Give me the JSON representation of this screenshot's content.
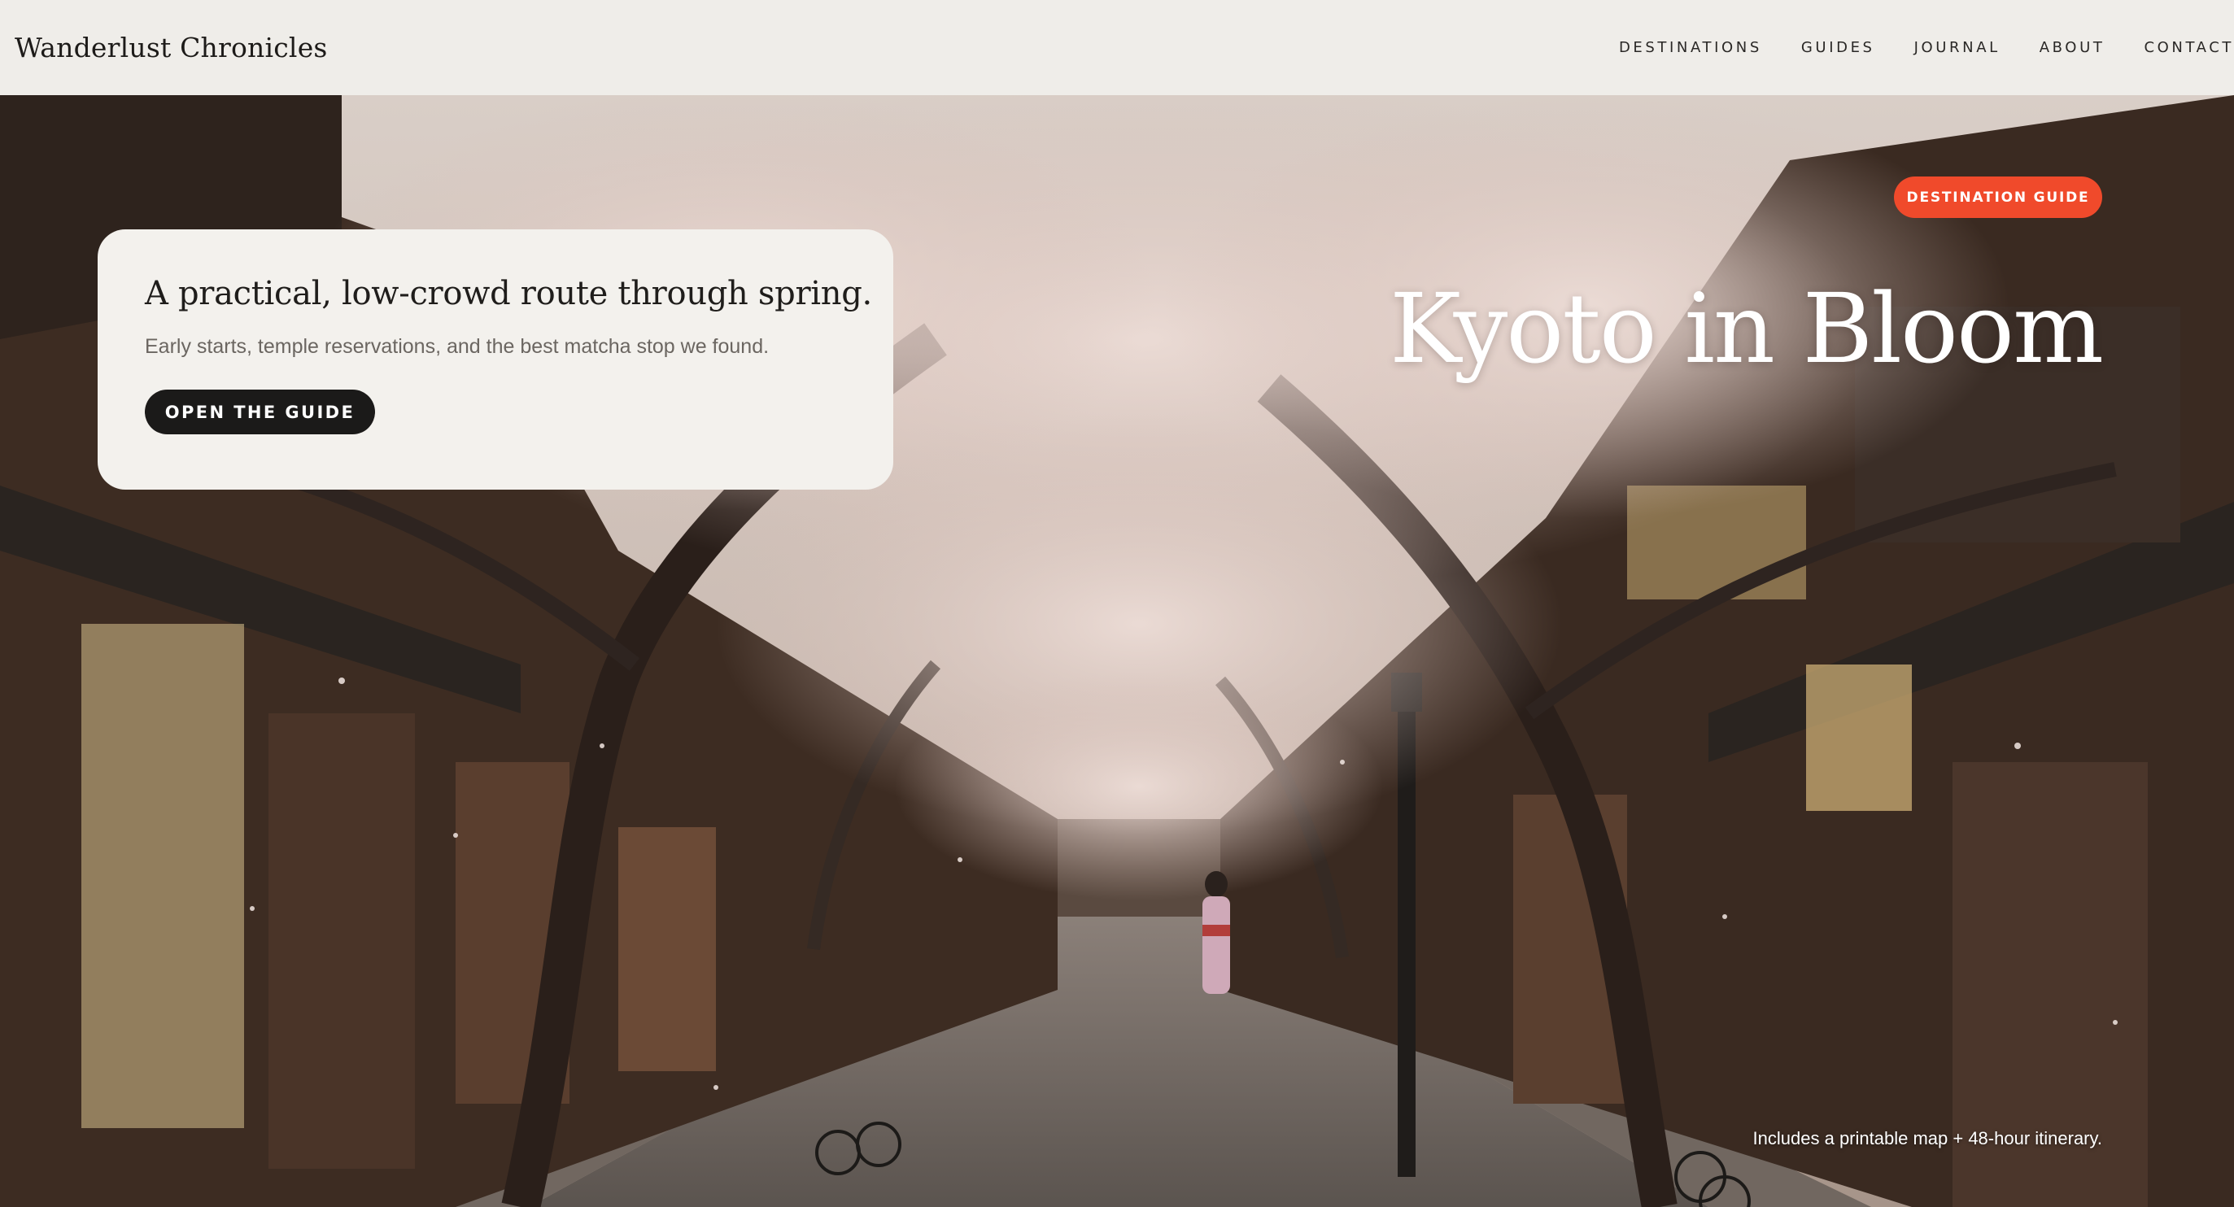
{
  "brand": "Wanderlust Chronicles",
  "nav": {
    "items": [
      "DESTINATIONS",
      "GUIDES",
      "JOURNAL",
      "ABOUT",
      "CONTACT"
    ]
  },
  "card": {
    "title": "A practical, low-crowd route through spring.",
    "subtitle": "Early starts, temple reservations, and the best matcha stop we found.",
    "cta_label": "OPEN THE GUIDE"
  },
  "hero": {
    "badge": "DESTINATION GUIDE",
    "title": "Kyoto in Bloom",
    "note": "Includes a printable map + 48-hour itinerary."
  },
  "colors": {
    "nav_bg": "#efede9",
    "card_bg": "#f3f1ed",
    "cta_bg": "#1b1a19",
    "badge_bg": "#f04a2b",
    "blossom": "#e8d4cf"
  }
}
